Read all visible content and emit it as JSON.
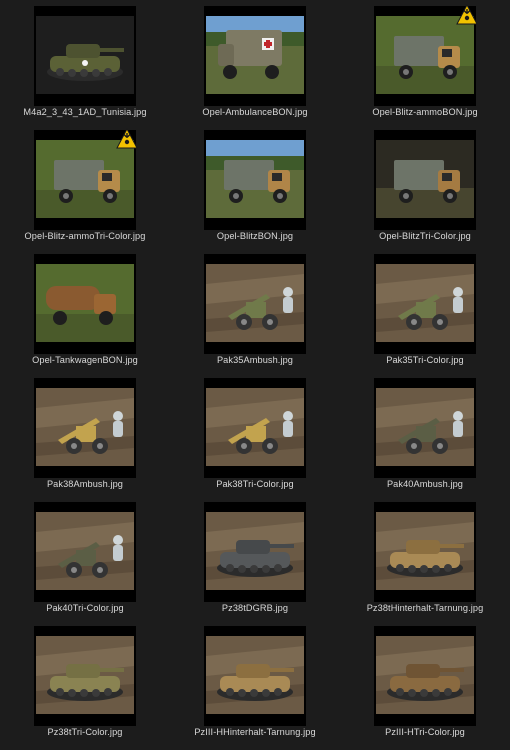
{
  "files": [
    {
      "name": "M4a2_3_43_1AD_Tunisia.jpg",
      "icon": "sherman-tank-image",
      "scene": "tank-green",
      "badge": false
    },
    {
      "name": "Opel-AmbulanceBON.jpg",
      "icon": "ambulance-truck-image",
      "scene": "ambulance",
      "badge": false
    },
    {
      "name": "Opel-Blitz-ammoBON.jpg",
      "icon": "truck-image",
      "scene": "truck-tan",
      "badge": true
    },
    {
      "name": "Opel-Blitz-ammoTri-Color.jpg",
      "icon": "truck-image",
      "scene": "truck-tan",
      "badge": true
    },
    {
      "name": "Opel-BlitzBON.jpg",
      "icon": "truck-image",
      "scene": "truck-tan-sky",
      "badge": false
    },
    {
      "name": "Opel-BlitzTri-Color.jpg",
      "icon": "truck-image",
      "scene": "truck-tan-dark",
      "badge": false
    },
    {
      "name": "Opel-TankwagenBON.jpg",
      "icon": "tanker-truck-image",
      "scene": "tanker",
      "badge": false
    },
    {
      "name": "Pak35Ambush.jpg",
      "icon": "anti-tank-gun-image",
      "scene": "gun-green",
      "badge": false
    },
    {
      "name": "Pak35Tri-Color.jpg",
      "icon": "anti-tank-gun-image",
      "scene": "gun-green",
      "badge": false
    },
    {
      "name": "Pak38Ambush.jpg",
      "icon": "anti-tank-gun-image",
      "scene": "gun-yellow",
      "badge": false
    },
    {
      "name": "Pak38Tri-Color.jpg",
      "icon": "anti-tank-gun-image",
      "scene": "gun-yellow",
      "badge": false
    },
    {
      "name": "Pak40Ambush.jpg",
      "icon": "anti-tank-gun-image",
      "scene": "gun-dark",
      "badge": false
    },
    {
      "name": "Pak40Tri-Color.jpg",
      "icon": "anti-tank-gun-image",
      "scene": "gun-dark",
      "badge": false
    },
    {
      "name": "Pz38tDGRB.jpg",
      "icon": "light-tank-image",
      "scene": "tank-grey",
      "badge": false
    },
    {
      "name": "Pz38tHinterhalt-Tarnung.jpg",
      "icon": "light-tank-image",
      "scene": "tank-tan",
      "badge": false
    },
    {
      "name": "Pz38tTri-Color.jpg",
      "icon": "light-tank-image",
      "scene": "tank-olive",
      "badge": false
    },
    {
      "name": "PzIII-HHinterhalt-Tarnung.jpg",
      "icon": "panzer-iii-image",
      "scene": "tank-tan",
      "badge": false
    },
    {
      "name": "PzIII-HTri-Color.jpg",
      "icon": "panzer-iii-image",
      "scene": "tank-brown",
      "badge": false
    }
  ],
  "badge_icon": "hazard-warning-icon",
  "colors": {
    "background": "#1c1c1c",
    "text": "#d9d9d9",
    "badge": "#f2c200"
  }
}
